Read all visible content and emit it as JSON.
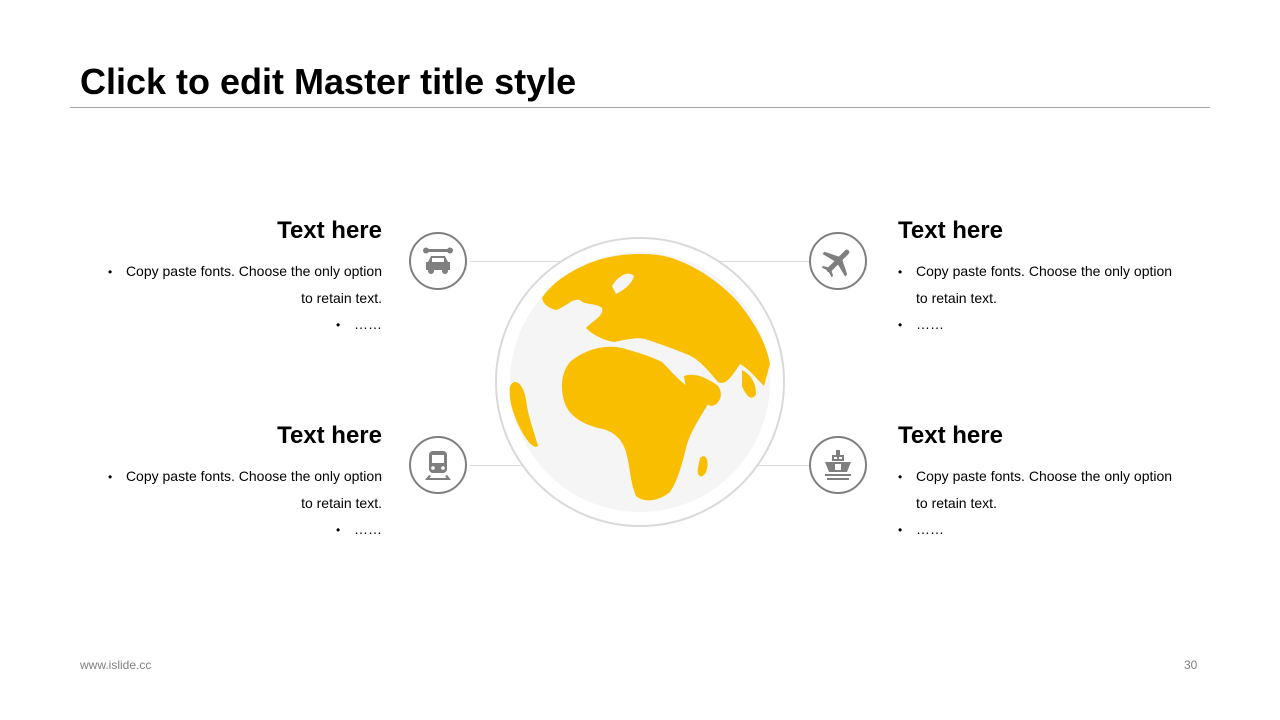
{
  "slide": {
    "title": "Click to edit Master title style",
    "footer_url": "www.islide.cc",
    "page_number": "30"
  },
  "blocks": [
    {
      "heading": "Text here",
      "line1": "Copy paste fonts. Choose the only option",
      "line2": "to retain text.",
      "line3": "……",
      "icon": "car-repair-icon"
    },
    {
      "heading": "Text here",
      "line1": "Copy paste fonts. Choose the only option",
      "line2": "to retain text.",
      "line3": "……",
      "icon": "airplane-icon"
    },
    {
      "heading": "Text here",
      "line1": "Copy paste fonts. Choose the only option",
      "line2": "to retain text.",
      "line3": "……",
      "icon": "train-icon"
    },
    {
      "heading": "Text here",
      "line1": "Copy paste fonts. Choose the only option",
      "line2": "to retain text.",
      "line3": "……",
      "icon": "ship-icon"
    }
  ],
  "colors": {
    "accent": "#F9BE00",
    "icon_gray": "#7F7F7F",
    "globe_ring": "#D9D9D9",
    "globe_fill": "#F5F5F5"
  }
}
